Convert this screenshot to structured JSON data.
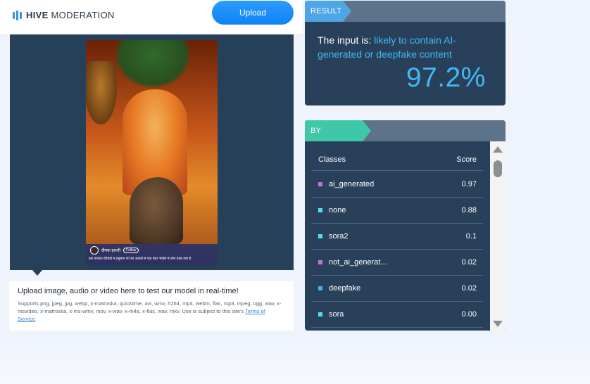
{
  "header": {
    "logo_brand": "HIVE",
    "logo_product": "MODERATION",
    "upload_label": "Upload"
  },
  "preview": {
    "channel_name": "दीपक हाथरी",
    "follow_label": "Follow",
    "subtitle": "इस वायरल वीडियो में हनुमान जी को आरती में एक बंदर भक्ति में लीन देखा गया है"
  },
  "info": {
    "title": "Upload image, audio or video here to test our model in real-time!",
    "body": "Supports png, jpeg, jpg, webp, x-matroska, quicktime, avi, wmv, h264, mp4, webm, flac, mp3, mpeg, ogg, wav, x-msvideo, x-matroska, x-ms-wmv, mov, x-wav, x-m4a, x-flac, wav, mkv. Use is subject to this site's ",
    "terms_link": "Terms of Service",
    "terms_suffix": "."
  },
  "result": {
    "tag": "RESULT",
    "prefix": "The input is: ",
    "verdict": "likely to contain AI-generated or deepfake content",
    "percent": "97.2%"
  },
  "classes": {
    "tag": "BY CLASSES",
    "col_class": "Classes",
    "col_score": "Score",
    "rows": [
      {
        "label": "ai_generated",
        "score": "0.97",
        "color": "#c46fe0"
      },
      {
        "label": "none",
        "score": "0.88",
        "color": "#56e0e0"
      },
      {
        "label": "sora2",
        "score": "0.1",
        "color": "#56e0e0"
      },
      {
        "label": "not_ai_generat...",
        "score": "0.02",
        "color": "#c46fe0"
      },
      {
        "label": "deepfake",
        "score": "0.02",
        "color": "#3fb2f0"
      },
      {
        "label": "sora",
        "score": "0.00",
        "color": "#56e0e0"
      }
    ]
  }
}
